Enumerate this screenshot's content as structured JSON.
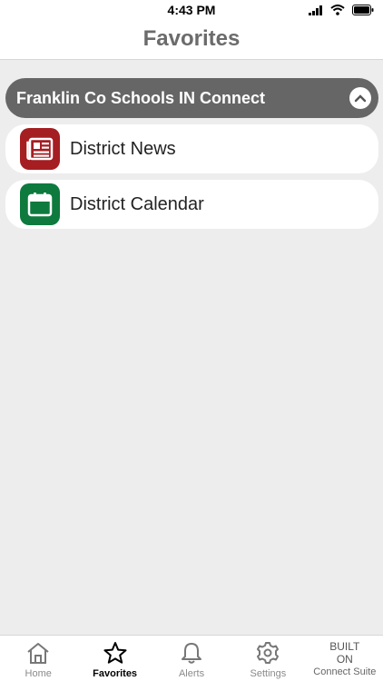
{
  "status_bar": {
    "time": "4:43 PM"
  },
  "header": {
    "title": "Favorites"
  },
  "group": {
    "title": "Franklin Co Schools IN Connect",
    "items": [
      {
        "label": "District News",
        "icon": "newspaper-icon",
        "color": "#a51e22"
      },
      {
        "label": "District Calendar",
        "icon": "calendar-icon",
        "color": "#0e7a3e"
      }
    ]
  },
  "tabs": [
    {
      "label": "Home",
      "icon": "home-icon"
    },
    {
      "label": "Favorites",
      "icon": "star-icon",
      "active": true
    },
    {
      "label": "Alerts",
      "icon": "bell-icon"
    },
    {
      "label": "Settings",
      "icon": "gear-icon"
    }
  ],
  "built_on": {
    "line1": "BUILT",
    "line2": "ON",
    "line3": "Connect Suite"
  },
  "colors": {
    "accent_gray": "#666666",
    "background": "#ededed"
  }
}
